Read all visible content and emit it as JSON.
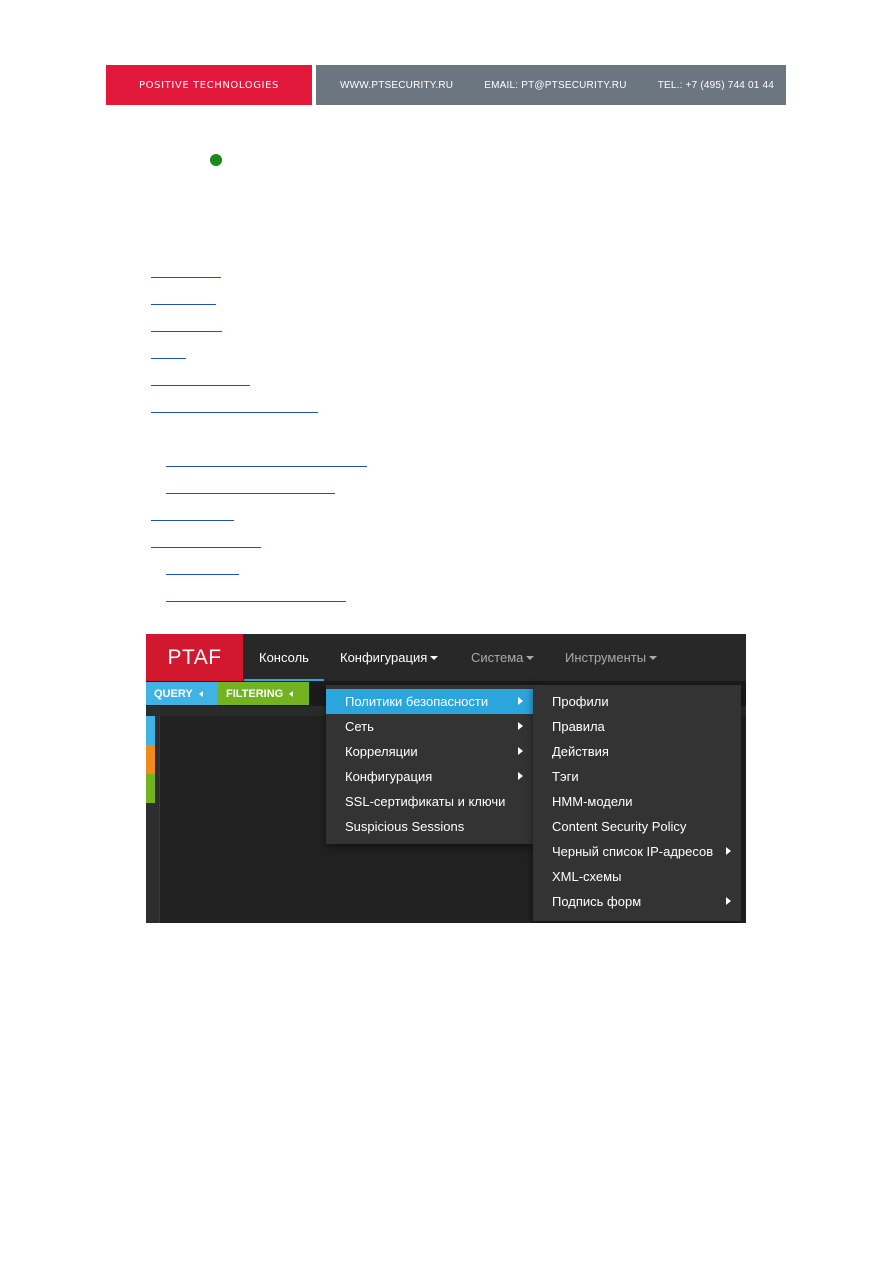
{
  "banner": {
    "company": "POSITIVE TECHNOLOGIES",
    "website": "WWW.PTSECURITY.RU",
    "email": "EMAIL: PT@PTSECURITY.RU",
    "phone": "TEL.: +7 (495) 744 01 44",
    "colors": {
      "red": "#e3193c",
      "gray": "#6c7680"
    }
  },
  "ptaf": {
    "logo": "PTAF",
    "nav": [
      {
        "label": "Консоль"
      },
      {
        "label": "Конфигурация"
      },
      {
        "label": "Система"
      },
      {
        "label": "Инструменты"
      }
    ],
    "chips": {
      "query": "QUERY",
      "filtering": "FILTERING"
    },
    "menu_config": [
      {
        "label": "Политики безопасности",
        "submenu": true,
        "selected": true
      },
      {
        "label": "Сеть",
        "submenu": true
      },
      {
        "label": "Корреляции",
        "submenu": true
      },
      {
        "label": "Конфигурация",
        "submenu": true
      },
      {
        "label": "SSL-сертификаты и ключи",
        "submenu": false
      },
      {
        "label": "Suspicious Sessions",
        "submenu": false
      }
    ],
    "menu_policies": [
      {
        "label": "Профили",
        "submenu": false
      },
      {
        "label": "Правила",
        "submenu": false
      },
      {
        "label": "Действия",
        "submenu": false
      },
      {
        "label": "Тэги",
        "submenu": false
      },
      {
        "label": "HMM-модели",
        "submenu": false
      },
      {
        "label": "Content Security Policy",
        "submenu": false
      },
      {
        "label": "Черный список IP-адресов",
        "submenu": true
      },
      {
        "label": "XML-схемы",
        "submenu": false
      },
      {
        "label": "Подпись форм",
        "submenu": true
      }
    ],
    "colors": {
      "accent": "#2ba6dd",
      "brand": "#d2182f",
      "query": "#3fb3e3",
      "filtering": "#73b321",
      "strip_orange": "#f08a1c"
    }
  }
}
